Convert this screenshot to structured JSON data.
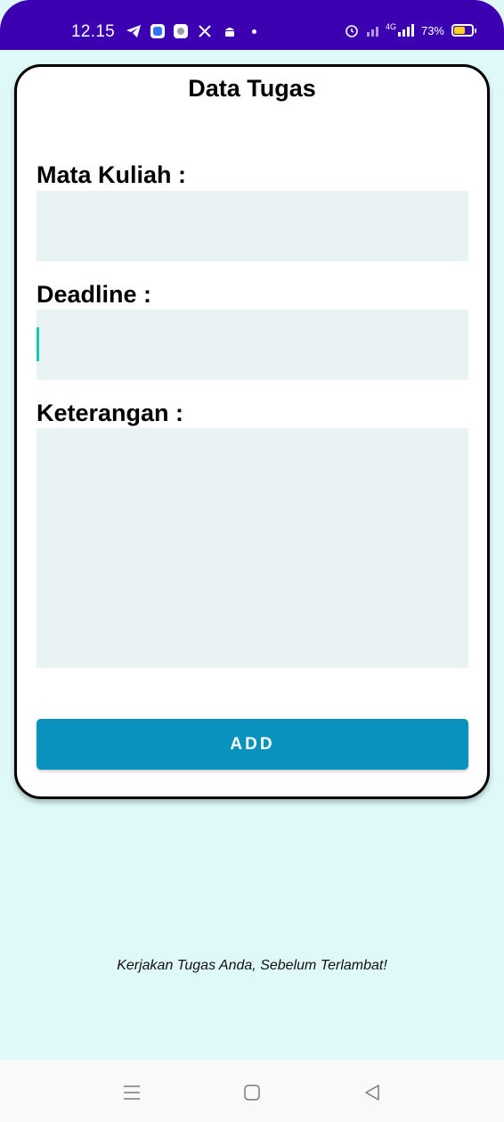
{
  "status_bar": {
    "time": "12.15",
    "icons_left": [
      "telegram-icon",
      "app-icon",
      "settings-app-icon",
      "x-icon",
      "android-icon",
      "dot-icon"
    ],
    "icons_right": [
      "alarm-icon",
      "signal-off-icon",
      "4g-signal-icon",
      "battery-icon"
    ],
    "network_label": "4G",
    "battery_text": "73%",
    "battery_level": 0.73,
    "bar_color": "#3b01b1"
  },
  "form": {
    "title": "Data Tugas",
    "fields": [
      {
        "label": "Mata Kuliah :",
        "value": ""
      },
      {
        "label": "Deadline :",
        "value": ""
      },
      {
        "label": "Keterangan :",
        "value": ""
      }
    ],
    "add_label": "ADD",
    "button_color": "#0892bd",
    "input_bg": "#e9f3f4"
  },
  "footer": {
    "tagline": "Kerjakan Tugas Anda, Sebelum Terlambat!"
  },
  "nav_bar": {
    "buttons": [
      "menu-icon",
      "home-icon",
      "back-icon"
    ]
  },
  "page_bg": "#dff9f9"
}
